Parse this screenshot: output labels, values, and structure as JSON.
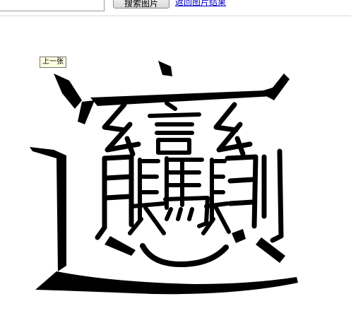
{
  "toolbar": {
    "search_value": "",
    "search_button_label": "搜索图片",
    "result_link_label": "返回图片结果"
  },
  "viewer": {
    "prev_label": "上一张"
  },
  "image": {
    "description_icon": "biang-character-icon",
    "ink_color": "#000000",
    "background_color": "#ffffff"
  }
}
